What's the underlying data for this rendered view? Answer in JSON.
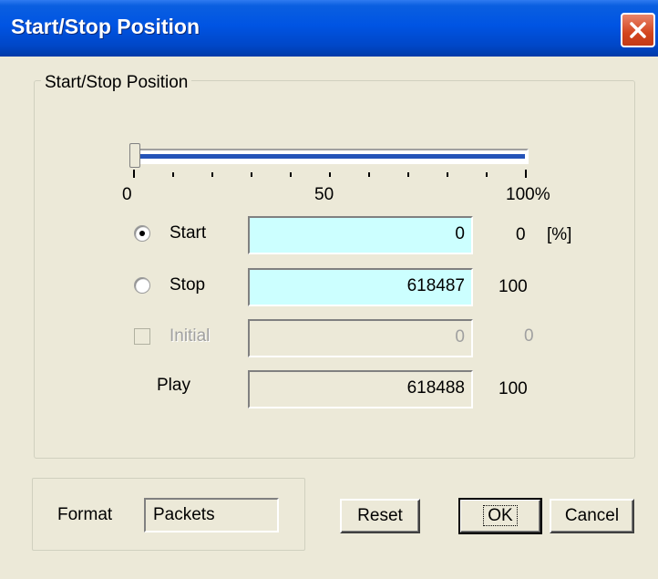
{
  "window": {
    "title": "Start/Stop Position"
  },
  "group": {
    "legend": "Start/Stop Position"
  },
  "slider": {
    "scale_labels": [
      "0",
      "50",
      "100%"
    ],
    "start_fraction": 0,
    "stop_fraction": 1
  },
  "rows": {
    "start": {
      "label": "Start",
      "value": "0",
      "percent": "0",
      "unit": "[%]",
      "selected": true
    },
    "stop": {
      "label": "Stop",
      "value": "618487",
      "percent": "100",
      "selected": false
    },
    "initial": {
      "label": "Initial",
      "value": "0",
      "percent": "0",
      "checked": false,
      "enabled": false
    },
    "play": {
      "label": "Play",
      "value": "618488",
      "percent": "100"
    }
  },
  "format": {
    "label": "Format",
    "value": "Packets"
  },
  "buttons": {
    "reset": "Reset",
    "ok": "OK",
    "cancel": "Cancel"
  },
  "icons": {
    "close": "close-icon"
  },
  "colors": {
    "titlebar": "#0054e3",
    "editable_field": "#ccffff",
    "close_button": "#d3451e"
  }
}
